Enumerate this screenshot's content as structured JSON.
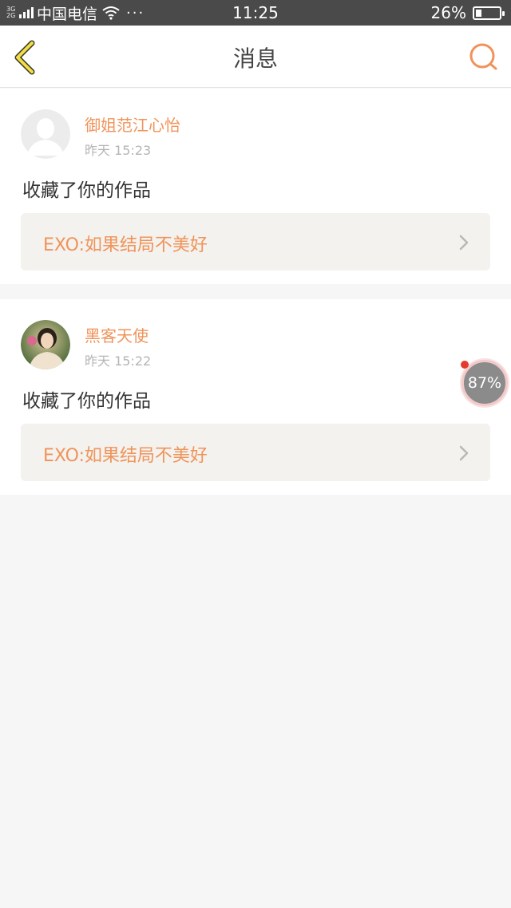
{
  "status_bar": {
    "network": "3G\n2G",
    "carrier": "中国电信",
    "menu_dots": "···",
    "time": "11:25",
    "battery_percent": "26%",
    "battery_level": 0.26
  },
  "header": {
    "title": "消息",
    "back_icon": "chevron-left-icon",
    "search_icon": "search-icon",
    "accent_color": "#f0935a"
  },
  "messages": [
    {
      "username": "御姐范江心怡",
      "time": "昨天 15:23",
      "action": "收藏了你的作品",
      "work_title": "EXO:如果结局不美好",
      "avatar": "default-avatar-icon"
    },
    {
      "username": "黑客天使",
      "time": "昨天 15:22",
      "action": "收藏了你的作品",
      "work_title": "EXO:如果结局不美好",
      "avatar": "user-photo-avatar"
    }
  ],
  "floating_widget": {
    "label": "87%"
  }
}
